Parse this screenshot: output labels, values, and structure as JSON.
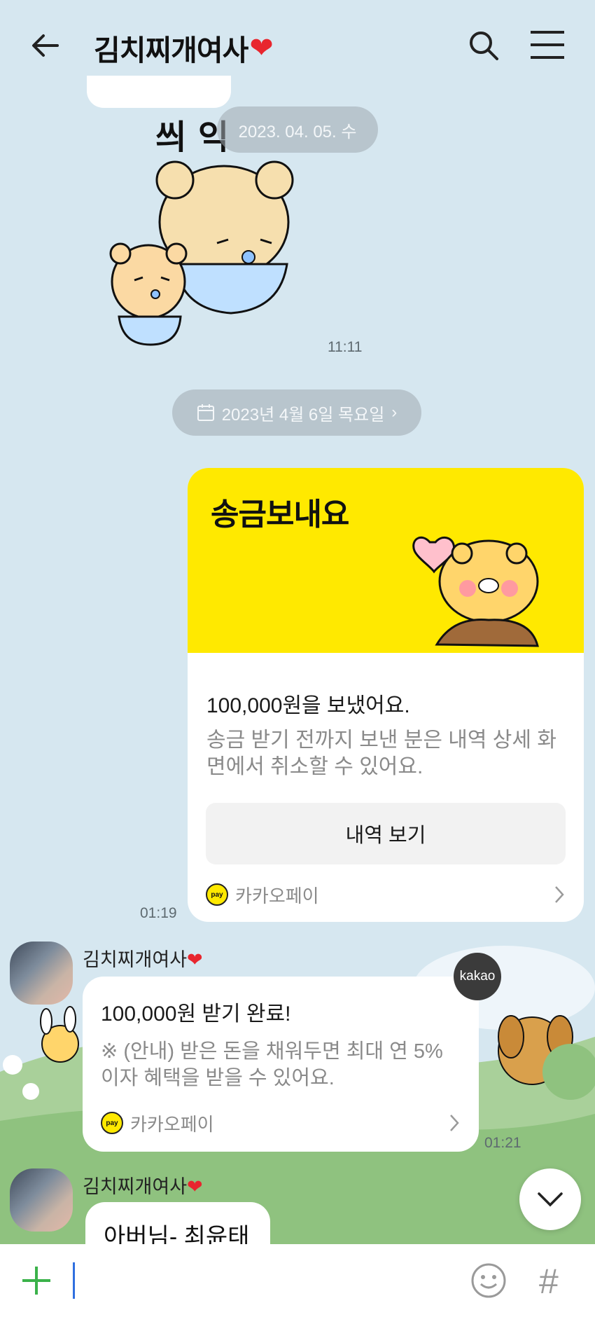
{
  "header": {
    "title": "김치찌개여사",
    "title_heart": "❤",
    "back_icon": "arrow-left-icon",
    "search_icon": "search-icon",
    "menu_icon": "hamburger-menu-icon"
  },
  "chat": {
    "date_top": "2023. 04. 05. 수",
    "sticker_text": "씌 익",
    "sticker_time": "11:11",
    "date_divider": "2023년 4월 6일 목요일",
    "date_divider_chevron": "›",
    "transfer": {
      "heading": "송금보내요",
      "amount": "100,000원을 보냈어요.",
      "description": "송금 받기 전까지 보낸 분은 내역 상세 화면에서 취소할 수 있어요.",
      "button": "내역 보기",
      "brand": "카카오페이",
      "logo_text": "pay",
      "time": "01:19"
    },
    "sender_name": "김치찌개여사",
    "sender_heart": "❤",
    "receipt": {
      "title": "100,000원 받기 완료!",
      "description": "※ (안내) 받은 돈을 채워두면 최대 연 5% 이자 혜택을 받을 수 있어요.",
      "brand": "카카오페이",
      "logo_text": "pay",
      "badge": "kakao",
      "time": "01:21"
    },
    "sender_name_2": "김치찌개여사",
    "sender_heart_2": "❤",
    "last_message": "아버님- 최윤태"
  },
  "input_bar": {
    "plus_icon": "plus-icon",
    "emoji_icon": "emoji-icon",
    "hash_label": "#"
  },
  "colors": {
    "background": "#d6e7f0",
    "pay_yellow": "#ffe900",
    "heart_red": "#e8262e"
  }
}
